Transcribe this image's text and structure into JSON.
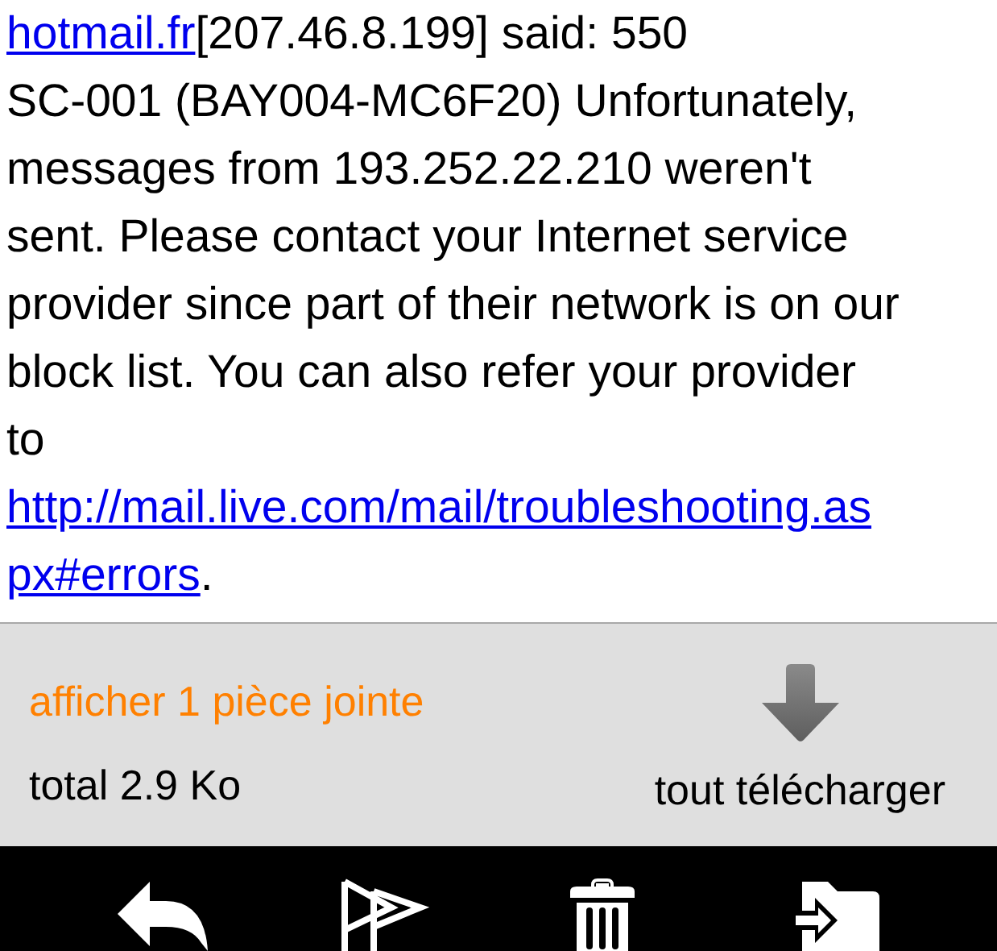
{
  "message_lines": [
    [
      {
        "text": "hotmail.fr",
        "link": true
      },
      {
        "text": "[207.46.8.199] said: 550",
        "link": false
      }
    ],
    [
      {
        "text": "SC-001 (BAY004-MC6F20) Unfortunately,",
        "link": false
      }
    ],
    [
      {
        "text": "messages from 193.252.22.210 weren't",
        "link": false
      }
    ],
    [
      {
        "text": "sent. Please contact your Internet service",
        "link": false
      }
    ],
    [
      {
        "text": "provider since part of their network is on our",
        "link": false
      }
    ],
    [
      {
        "text": "block list. You can also refer your provider",
        "link": false
      }
    ],
    [
      {
        "text": "to",
        "link": false
      }
    ],
    [
      {
        "text": "http://mail.live.com/mail/troubleshooting.as",
        "link": true
      }
    ],
    [
      {
        "text": "px#errors",
        "link": true
      },
      {
        "text": ".",
        "link": false
      }
    ]
  ],
  "attachments": {
    "show_link": "afficher 1 pièce jointe",
    "total": "total 2.9 Ko",
    "download_all": "tout télécharger"
  },
  "toolbar": [
    {
      "kind": "reply"
    },
    {
      "kind": "flag"
    },
    {
      "kind": "delete"
    },
    {
      "kind": "move"
    }
  ]
}
